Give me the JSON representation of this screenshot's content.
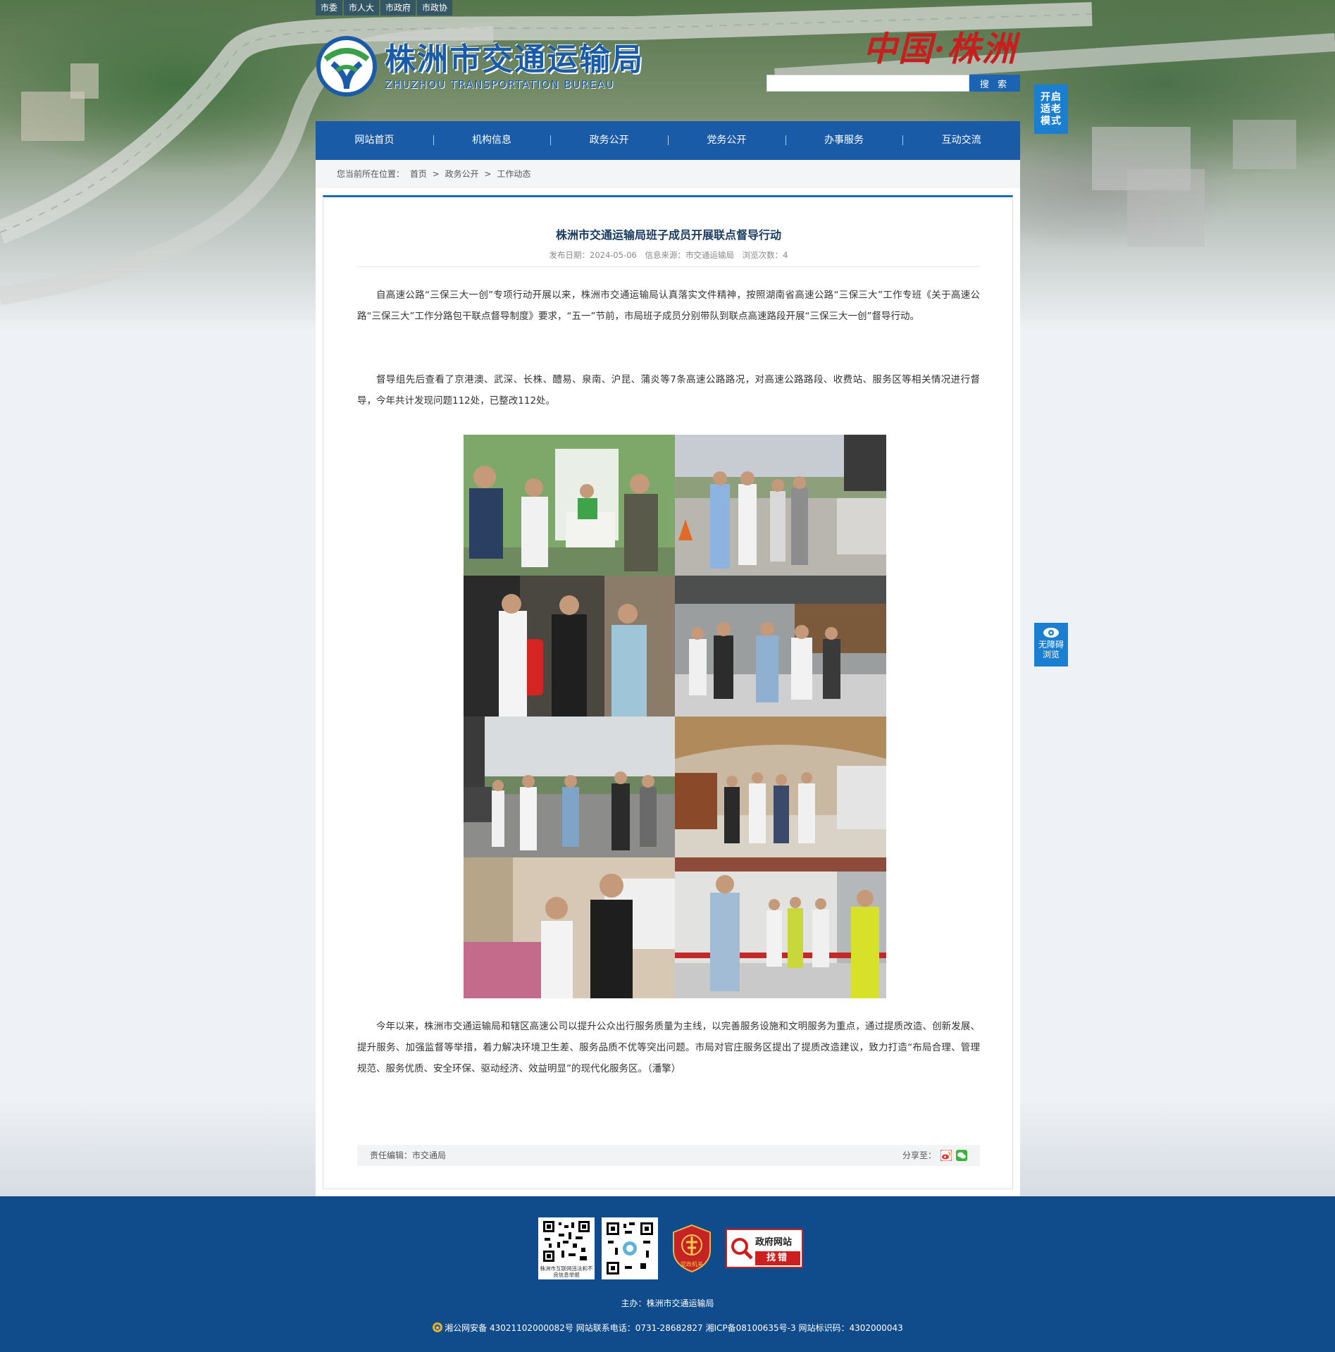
{
  "topnav": [
    "市委",
    "市人大",
    "市政府",
    "市政协"
  ],
  "logo": {
    "cn": "株洲市交通运输局",
    "en": "ZHUZHOU TRANSPORTATION BUREAU"
  },
  "brand_script": "中国·株洲",
  "search": {
    "value": "",
    "button": "搜 索"
  },
  "elder_mode": "开启适老模式",
  "accessibility": "无障碍浏览",
  "mainnav": [
    "网站首页",
    "机构信息",
    "政务公开",
    "党务公开",
    "办事服务",
    "互动交流"
  ],
  "breadcrumb": {
    "prefix": "您当前所在位置：",
    "items": [
      "首页",
      "政务公开",
      "工作动态"
    ],
    "sep": ">"
  },
  "article": {
    "title": "株洲市交通运输局班子成员开展联点督导行动",
    "publish_date": "发布日期：2024-05-06",
    "source": "信息来源：市交通运输局",
    "views": "浏览次数：4",
    "para1": "自高速公路“三保三大一创”专项行动开展以来，株洲市交通运输局认真落实文件精神，按照湖南省高速公路“三保三大”工作专班《关于高速公路“三保三大”工作分路包干联点督导制度》要求，“五一”节前，市局班子成员分别带队到联点高速路段开展“三保三大一创”督导行动。",
    "para2": "督导组先后查看了京港澳、武深、长株、醴易、泉南、沪昆、蒲炎等7条高速公路路况，对高速公路路段、收费站、服务区等相关情况进行督导，今年共计发现问题112处，已整改112处。",
    "para3": "今年以来，株洲市交通运输局和辖区高速公司以提升公众出行服务质量为主线，以完善服务设施和文明服务为重点，通过提质改造、创新发展、提升服务、加强监督等举措，着力解决环境卫生差、服务品质不优等突出问题。市局对官庄服务区提出了提质改造建议，致力打造“布局合理、管理规范、服务优质、安全环保、驱动经济、效益明显”的现代化服务区。（潘擎）",
    "editor": "责任编辑：市交通局",
    "share_label": "分享至："
  },
  "footer": {
    "qr1_caption": "株洲市互联网违法和不良信息举报",
    "party_label": "党政机关",
    "gov_error_1": "政府网站",
    "gov_error_2": "找错",
    "host": "主办：株洲市交通运输局",
    "registration": "湘公网安备 43021102000082号 网站联系电话：0731-28682827 湘ICP备08100635号-3 网站标识码：4302000043"
  },
  "colors": {
    "nav_blue": "#1a5ba8",
    "footer_blue": "#104b8c",
    "accent_red": "#cc1f1f"
  }
}
